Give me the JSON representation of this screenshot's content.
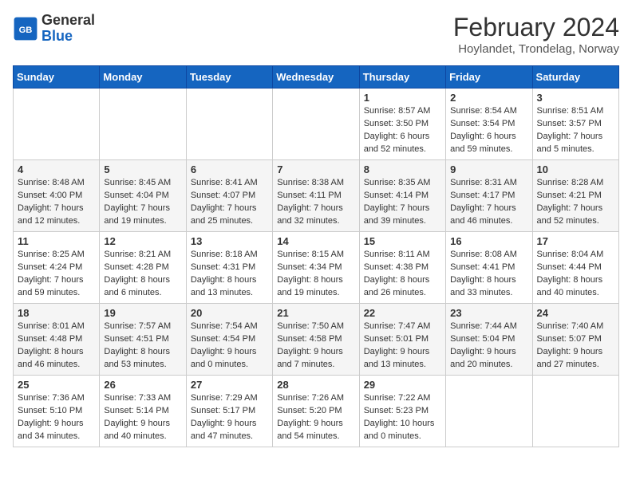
{
  "header": {
    "logo_general": "General",
    "logo_blue": "Blue",
    "title": "February 2024",
    "subtitle": "Hoylandet, Trondelag, Norway"
  },
  "days_of_week": [
    "Sunday",
    "Monday",
    "Tuesday",
    "Wednesday",
    "Thursday",
    "Friday",
    "Saturday"
  ],
  "weeks": [
    [
      {
        "day": "",
        "info": ""
      },
      {
        "day": "",
        "info": ""
      },
      {
        "day": "",
        "info": ""
      },
      {
        "day": "",
        "info": ""
      },
      {
        "day": "1",
        "info": "Sunrise: 8:57 AM\nSunset: 3:50 PM\nDaylight: 6 hours\nand 52 minutes."
      },
      {
        "day": "2",
        "info": "Sunrise: 8:54 AM\nSunset: 3:54 PM\nDaylight: 6 hours\nand 59 minutes."
      },
      {
        "day": "3",
        "info": "Sunrise: 8:51 AM\nSunset: 3:57 PM\nDaylight: 7 hours\nand 5 minutes."
      }
    ],
    [
      {
        "day": "4",
        "info": "Sunrise: 8:48 AM\nSunset: 4:00 PM\nDaylight: 7 hours\nand 12 minutes."
      },
      {
        "day": "5",
        "info": "Sunrise: 8:45 AM\nSunset: 4:04 PM\nDaylight: 7 hours\nand 19 minutes."
      },
      {
        "day": "6",
        "info": "Sunrise: 8:41 AM\nSunset: 4:07 PM\nDaylight: 7 hours\nand 25 minutes."
      },
      {
        "day": "7",
        "info": "Sunrise: 8:38 AM\nSunset: 4:11 PM\nDaylight: 7 hours\nand 32 minutes."
      },
      {
        "day": "8",
        "info": "Sunrise: 8:35 AM\nSunset: 4:14 PM\nDaylight: 7 hours\nand 39 minutes."
      },
      {
        "day": "9",
        "info": "Sunrise: 8:31 AM\nSunset: 4:17 PM\nDaylight: 7 hours\nand 46 minutes."
      },
      {
        "day": "10",
        "info": "Sunrise: 8:28 AM\nSunset: 4:21 PM\nDaylight: 7 hours\nand 52 minutes."
      }
    ],
    [
      {
        "day": "11",
        "info": "Sunrise: 8:25 AM\nSunset: 4:24 PM\nDaylight: 7 hours\nand 59 minutes."
      },
      {
        "day": "12",
        "info": "Sunrise: 8:21 AM\nSunset: 4:28 PM\nDaylight: 8 hours\nand 6 minutes."
      },
      {
        "day": "13",
        "info": "Sunrise: 8:18 AM\nSunset: 4:31 PM\nDaylight: 8 hours\nand 13 minutes."
      },
      {
        "day": "14",
        "info": "Sunrise: 8:15 AM\nSunset: 4:34 PM\nDaylight: 8 hours\nand 19 minutes."
      },
      {
        "day": "15",
        "info": "Sunrise: 8:11 AM\nSunset: 4:38 PM\nDaylight: 8 hours\nand 26 minutes."
      },
      {
        "day": "16",
        "info": "Sunrise: 8:08 AM\nSunset: 4:41 PM\nDaylight: 8 hours\nand 33 minutes."
      },
      {
        "day": "17",
        "info": "Sunrise: 8:04 AM\nSunset: 4:44 PM\nDaylight: 8 hours\nand 40 minutes."
      }
    ],
    [
      {
        "day": "18",
        "info": "Sunrise: 8:01 AM\nSunset: 4:48 PM\nDaylight: 8 hours\nand 46 minutes."
      },
      {
        "day": "19",
        "info": "Sunrise: 7:57 AM\nSunset: 4:51 PM\nDaylight: 8 hours\nand 53 minutes."
      },
      {
        "day": "20",
        "info": "Sunrise: 7:54 AM\nSunset: 4:54 PM\nDaylight: 9 hours\nand 0 minutes."
      },
      {
        "day": "21",
        "info": "Sunrise: 7:50 AM\nSunset: 4:58 PM\nDaylight: 9 hours\nand 7 minutes."
      },
      {
        "day": "22",
        "info": "Sunrise: 7:47 AM\nSunset: 5:01 PM\nDaylight: 9 hours\nand 13 minutes."
      },
      {
        "day": "23",
        "info": "Sunrise: 7:44 AM\nSunset: 5:04 PM\nDaylight: 9 hours\nand 20 minutes."
      },
      {
        "day": "24",
        "info": "Sunrise: 7:40 AM\nSunset: 5:07 PM\nDaylight: 9 hours\nand 27 minutes."
      }
    ],
    [
      {
        "day": "25",
        "info": "Sunrise: 7:36 AM\nSunset: 5:10 PM\nDaylight: 9 hours\nand 34 minutes."
      },
      {
        "day": "26",
        "info": "Sunrise: 7:33 AM\nSunset: 5:14 PM\nDaylight: 9 hours\nand 40 minutes."
      },
      {
        "day": "27",
        "info": "Sunrise: 7:29 AM\nSunset: 5:17 PM\nDaylight: 9 hours\nand 47 minutes."
      },
      {
        "day": "28",
        "info": "Sunrise: 7:26 AM\nSunset: 5:20 PM\nDaylight: 9 hours\nand 54 minutes."
      },
      {
        "day": "29",
        "info": "Sunrise: 7:22 AM\nSunset: 5:23 PM\nDaylight: 10 hours\nand 0 minutes."
      },
      {
        "day": "",
        "info": ""
      },
      {
        "day": "",
        "info": ""
      }
    ]
  ]
}
